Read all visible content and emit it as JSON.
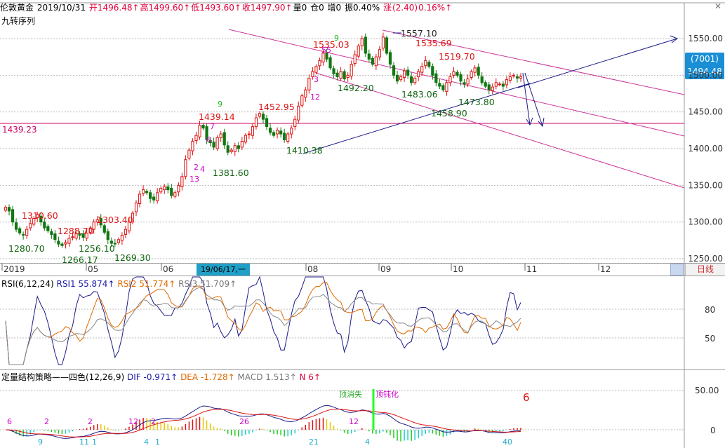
{
  "header": {
    "name": "伦敦黄金",
    "date": "2019/10/31",
    "open": "开1496.48↑",
    "high": "高1499.60↑",
    "low": "低1493.60↑",
    "close": "收1497.90↑",
    "volume": "量0",
    "position": "仓0",
    "increase": "增0",
    "amplitude": "振0.40%",
    "change_label": "涨",
    "change_value": "(2.40)",
    "change_pct": "0.16%↑"
  },
  "indicator_label": "九转序列",
  "price_tag": {
    "line1": "(7001)",
    "line2": "1494.48"
  },
  "hline_label": "1439.23",
  "period_label": "日线",
  "date_cursor": "19/06/17,一",
  "x_labels": [
    "2019",
    "05",
    "06",
    "08",
    "09",
    "10",
    "11",
    "12"
  ],
  "rsi": {
    "title": "RSI(6,12,24)",
    "rsi1": "RSI1 55.874↑",
    "rsi2": "RSI2 51.774↑",
    "rsi3": "RSI3 51.709↑",
    "axis": [
      "80",
      "50"
    ]
  },
  "macd": {
    "title": "定量结构策略——四色(12,26,9)",
    "dif": "DIF -0.971↑",
    "dea": "DEA -1.728↑",
    "macd": "MACD 1.513↑",
    "n": "N 6↑",
    "big_number": "6",
    "axis": [
      "50.00",
      "0"
    ],
    "annotations": [
      "顶消失",
      "顶钝化"
    ],
    "bottom_counts": [
      "9",
      "11",
      "1",
      "4",
      "1",
      "21",
      "4",
      "40"
    ],
    "top_counts": [
      "6",
      "2",
      "2",
      "12",
      "2",
      "26",
      "12"
    ]
  },
  "chart_data": {
    "type": "candlestick",
    "title": "伦敦黄金",
    "y_axis_ticks": [
      1550.0,
      1500.0,
      1450.0,
      1400.0,
      1350.0,
      1300.0,
      1250.0
    ],
    "ylim": [
      1245,
      1572
    ],
    "x_ticks": [
      "2019",
      "05",
      "06",
      "08",
      "09",
      "10",
      "11",
      "12"
    ],
    "horizontal_line": 1439.23,
    "price_annotations": [
      {
        "label": "1310.60",
        "color": "#dd1111"
      },
      {
        "label": "1280.70",
        "color": "#116611"
      },
      {
        "label": "1288.70",
        "color": "#dd1111"
      },
      {
        "label": "1266.17",
        "color": "#116611"
      },
      {
        "label": "1256.10",
        "color": "#116611"
      },
      {
        "label": "1303.40",
        "color": "#dd1111"
      },
      {
        "label": "1269.30",
        "color": "#116611"
      },
      {
        "label": "1381.60",
        "color": "#116611"
      },
      {
        "label": "1439.14",
        "color": "#dd1111"
      },
      {
        "label": "1452.95",
        "color": "#dd1111"
      },
      {
        "label": "1410.38",
        "color": "#116611"
      },
      {
        "label": "1535.03",
        "color": "#dd1111"
      },
      {
        "label": "1492.20",
        "color": "#116611"
      },
      {
        "label": "1557.10",
        "color": "#222222"
      },
      {
        "label": "1535.69",
        "color": "#dd1111"
      },
      {
        "label": "1519.70",
        "color": "#dd1111"
      },
      {
        "label": "1483.06",
        "color": "#116611"
      },
      {
        "label": "1473.80",
        "color": "#116611"
      },
      {
        "label": "1458.90",
        "color": "#116611"
      }
    ],
    "close_series": [
      1320,
      1315,
      1300,
      1290,
      1285,
      1282,
      1290,
      1298,
      1305,
      1310,
      1300,
      1292,
      1288,
      1283,
      1276,
      1270,
      1268,
      1272,
      1278,
      1280,
      1284,
      1282,
      1279,
      1285,
      1292,
      1300,
      1303,
      1296,
      1286,
      1276,
      1271,
      1270,
      1276,
      1282,
      1290,
      1300,
      1312,
      1326,
      1338,
      1344,
      1340,
      1332,
      1330,
      1340,
      1346,
      1348,
      1344,
      1336,
      1340,
      1350,
      1362,
      1385,
      1398,
      1410,
      1418,
      1432,
      1428,
      1412,
      1408,
      1402,
      1415,
      1420,
      1405,
      1395,
      1398,
      1404,
      1400,
      1410,
      1418,
      1420,
      1430,
      1442,
      1448,
      1440,
      1430,
      1422,
      1418,
      1425,
      1420,
      1412,
      1420,
      1428,
      1440,
      1458,
      1472,
      1480,
      1496,
      1505,
      1512,
      1520,
      1530,
      1522,
      1510,
      1502,
      1498,
      1505,
      1495,
      1500,
      1515,
      1528,
      1540,
      1550,
      1530,
      1522,
      1515,
      1525,
      1535,
      1552,
      1530,
      1515,
      1500,
      1492,
      1498,
      1506,
      1500,
      1490,
      1496,
      1505,
      1512,
      1520,
      1512,
      1500,
      1490,
      1485,
      1480,
      1490,
      1498,
      1505,
      1500,
      1492,
      1488,
      1495,
      1505,
      1510,
      1500,
      1490,
      1485,
      1480,
      1484,
      1490,
      1488,
      1485,
      1494,
      1498,
      1500,
      1496,
      1498
    ]
  }
}
